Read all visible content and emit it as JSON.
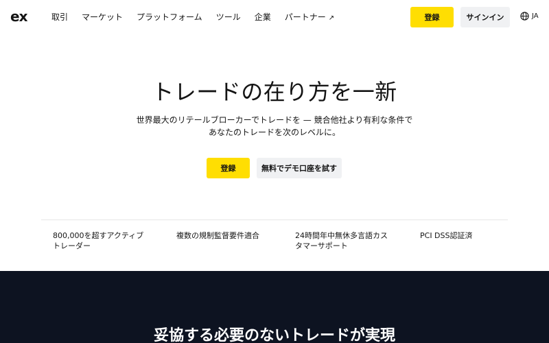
{
  "header": {
    "logo": "ex",
    "nav": [
      {
        "label": "取引"
      },
      {
        "label": "マーケット"
      },
      {
        "label": "プラットフォーム"
      },
      {
        "label": "ツール"
      },
      {
        "label": "企業"
      },
      {
        "label": "パートナー",
        "external_mark": "↗"
      }
    ],
    "register_label": "登録",
    "signin_label": "サインイン",
    "language": "JA"
  },
  "hero": {
    "title": "トレードの在り方を一新",
    "subtitle": "世界最大のリテールブローカーでトレードを — 競合他社より有利な条件であなたのトレードを次のレベルに。",
    "register_label": "登録",
    "demo_label": "無料でデモ口座を試す"
  },
  "features": [
    {
      "text": "800,000を超すアクティブトレーダー"
    },
    {
      "text": "複数の規制監督要件適合"
    },
    {
      "text": "24時間年中無休多言語カスタマーサポート"
    },
    {
      "text": "PCI DSS認証済"
    }
  ],
  "section2": {
    "title": "妥協する必要のないトレードが実現"
  },
  "colors": {
    "accent": "#ffde02",
    "dark_bg": "#0d1321",
    "secondary_button": "#f0f1f3"
  }
}
